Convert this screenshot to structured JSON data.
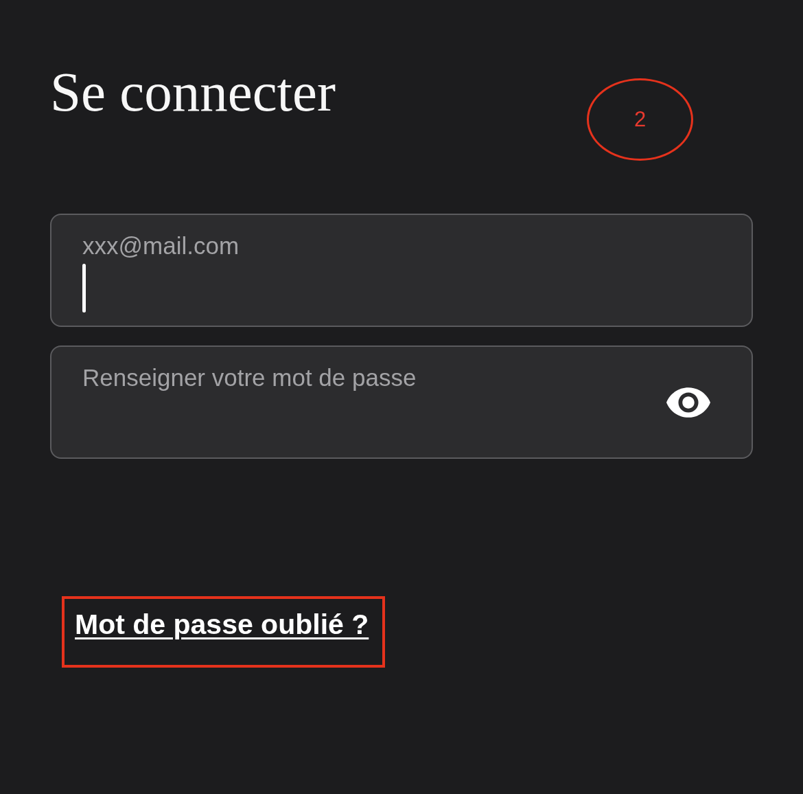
{
  "title": "Se connecter",
  "annotation": {
    "label": "2"
  },
  "fields": [
    {
      "kind": "email",
      "placeholder": "xxx@mail.com",
      "focused": true
    },
    {
      "kind": "password",
      "placeholder": "Renseigner votre mot de passe",
      "focused": false
    }
  ],
  "forgot_password_link": {
    "text": "Mot de passe oublié ?",
    "highlighted": true
  }
}
